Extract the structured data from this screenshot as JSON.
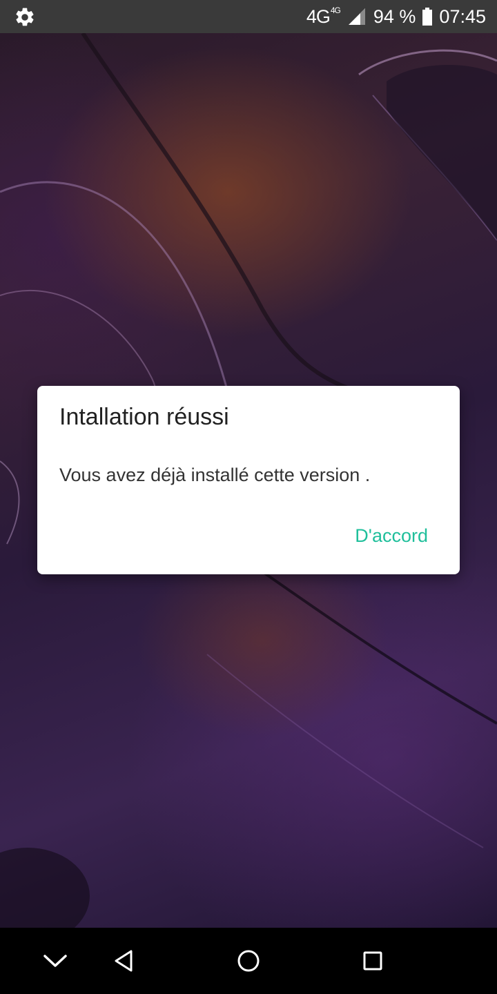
{
  "status_bar": {
    "network": "4G",
    "network_badge": "4G",
    "battery": "94 %",
    "time": "07:45",
    "icons": [
      "gear-icon",
      "signal-icon",
      "battery-icon"
    ]
  },
  "dialog": {
    "title": "Intallation réussi",
    "message": "Vous avez déjà installé cette version .",
    "ok_button": "D'accord"
  },
  "nav_bar": {
    "icons": [
      "chevron-down-icon",
      "back-icon",
      "home-icon",
      "recents-icon"
    ]
  },
  "colors": {
    "accent": "#1fbf9b",
    "status_bar_bg": "#3a3a3a",
    "nav_bar_bg": "#000000",
    "dialog_bg": "#ffffff"
  }
}
